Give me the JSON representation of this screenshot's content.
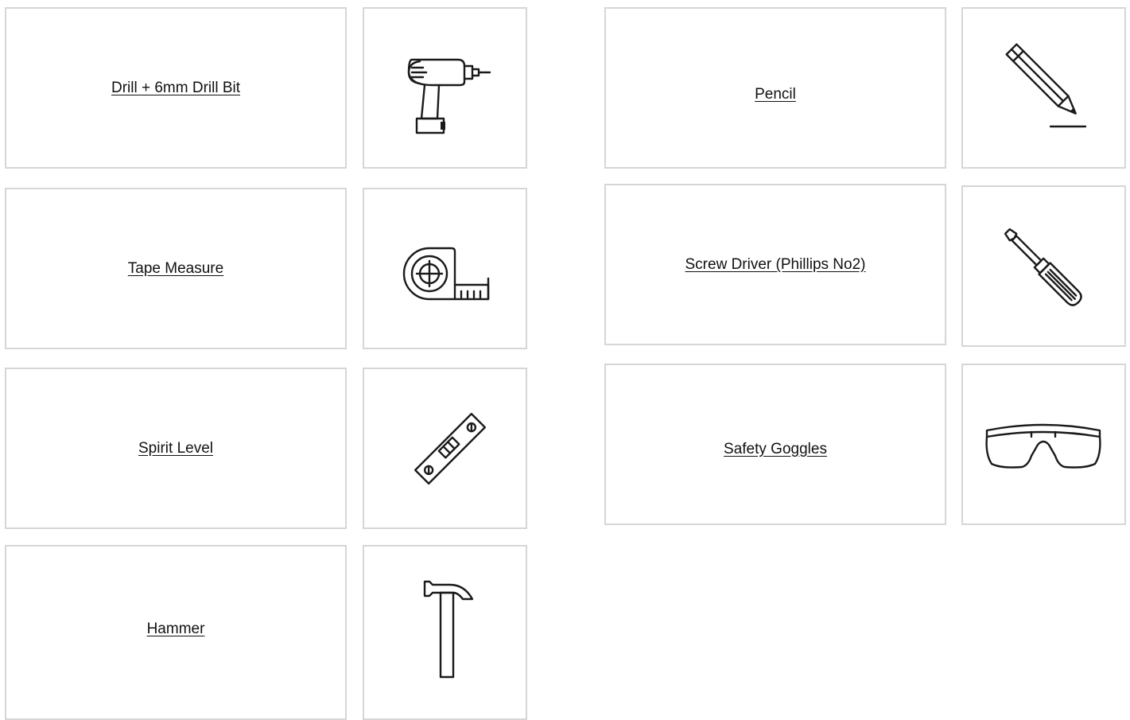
{
  "tools": {
    "drill": {
      "label": "Drill + 6mm Drill Bit",
      "icon": "drill-icon"
    },
    "tape": {
      "label": "Tape Measure",
      "icon": "tape-measure-icon"
    },
    "level": {
      "label": "Spirit Level",
      "icon": "spirit-level-icon"
    },
    "hammer": {
      "label": "Hammer",
      "icon": "hammer-icon"
    },
    "pencil": {
      "label": "Pencil",
      "icon": "pencil-icon"
    },
    "screwdriver": {
      "label": "Screw Driver (Phillips No2)",
      "icon": "screwdriver-icon"
    },
    "goggles": {
      "label": "Safety Goggles",
      "icon": "safety-goggles-icon"
    }
  },
  "colors": {
    "border": "#d6d6d6",
    "text": "#111111",
    "icon": "#1a1a1a"
  }
}
